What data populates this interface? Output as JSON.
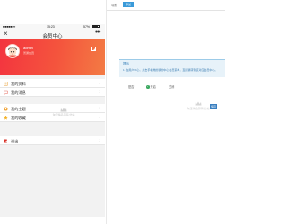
{
  "phone": {
    "status": {
      "carrier": "■■■■■ ≋",
      "time": "15:23",
      "battery": "57%"
    },
    "nav": {
      "close_label": "×",
      "title": "会员中心",
      "more_label": "•••"
    },
    "profile": {
      "name": "admin",
      "tag": "普通会员"
    },
    "menu_primary": [
      {
        "label": "我的资料",
        "icon": "profile-icon"
      },
      {
        "label": "我的消息",
        "icon": "message-icon"
      }
    ],
    "menu_secondary": [
      {
        "label": "我的主题",
        "icon": "theme-icon"
      },
      {
        "label": "我的收藏",
        "icon": "favorite-icon"
      }
    ],
    "menu_logout": {
      "label": "退出",
      "icon": "logout-icon"
    },
    "chevron": "›",
    "watermark": "淘宝精品源码 仿站"
  },
  "web": {
    "field_label": "导航",
    "top_button": "添加",
    "tip_title": "提示",
    "tip_text": "1. 在用户中心，点击手机端的我的中心会员菜单，直接跳转到该对应会员中心。",
    "options": [
      {
        "label": "是否"
      },
      {
        "label": "开启",
        "checked": true
      },
      {
        "label": "关闭"
      }
    ],
    "watermark": "淘宝精品源码 仿站",
    "side_button": "保存"
  },
  "colors": {
    "header_gradient_start": "#f3343f",
    "header_gradient_end": "#f37b44",
    "accent_blue": "#3a9ad9"
  }
}
